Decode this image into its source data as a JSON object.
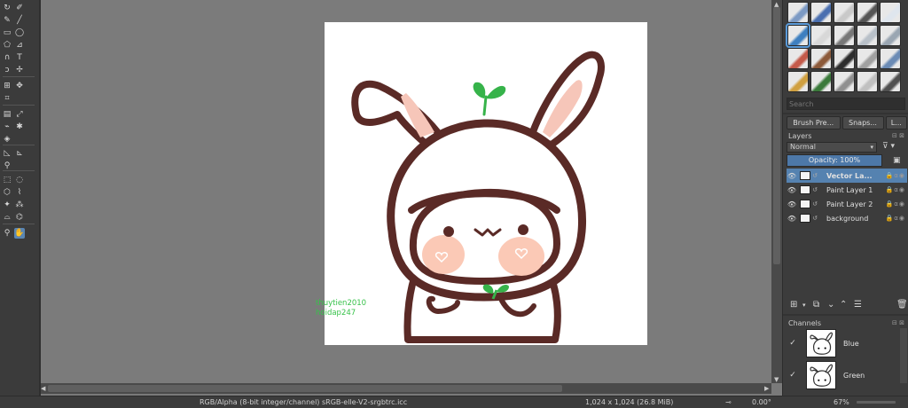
{
  "toolbox": {
    "tools": [
      {
        "name": "transform-tool-icon",
        "glyph": "↻"
      },
      {
        "name": "pick-tool-icon",
        "glyph": "✐"
      },
      {
        "name": "freehand-brush-icon",
        "glyph": "✎"
      },
      {
        "name": "line-tool-icon",
        "glyph": "╱"
      },
      {
        "name": "rectangle-tool-icon",
        "glyph": "▭"
      },
      {
        "name": "ellipse-tool-icon",
        "glyph": "◯"
      },
      {
        "name": "polygon-tool-icon",
        "glyph": "⬠"
      },
      {
        "name": "polyline-tool-icon",
        "glyph": "⊿"
      },
      {
        "name": "bezier-tool-icon",
        "glyph": "∩"
      },
      {
        "name": "text-tool-icon",
        "glyph": "T"
      },
      {
        "name": "freehand-path-icon",
        "glyph": "ↄ"
      },
      {
        "name": "multibrush-icon",
        "glyph": "✢"
      },
      {
        "name": "transform-layer-icon",
        "glyph": "⊞"
      },
      {
        "name": "move-tool-icon",
        "glyph": "✥"
      },
      {
        "name": "crop-tool-icon",
        "glyph": "⌗"
      },
      {
        "name": "gradient-tool-icon",
        "glyph": "▤"
      },
      {
        "name": "color-picker-icon",
        "glyph": "⤢"
      },
      {
        "name": "smart-patch-icon",
        "glyph": "⌁"
      },
      {
        "name": "assistant-tool-icon",
        "glyph": "✱"
      },
      {
        "name": "fill-tool-icon",
        "glyph": "◈"
      },
      {
        "name": "measure-tool-icon",
        "glyph": "◺"
      },
      {
        "name": "reference-tool-icon",
        "glyph": "⊾"
      },
      {
        "name": "pin-tool-icon",
        "glyph": "⚲"
      },
      {
        "name": "rect-select-icon",
        "glyph": "⬚"
      },
      {
        "name": "ellipse-select-icon",
        "glyph": "◌"
      },
      {
        "name": "polygon-select-icon",
        "glyph": "⬡"
      },
      {
        "name": "freehand-select-icon",
        "glyph": "⌇"
      },
      {
        "name": "contiguous-select-icon",
        "glyph": "✦"
      },
      {
        "name": "similar-select-icon",
        "glyph": "⁂"
      },
      {
        "name": "bezier-select-icon",
        "glyph": "⌓"
      },
      {
        "name": "magnetic-select-icon",
        "glyph": "⌬"
      },
      {
        "name": "zoom-tool-icon",
        "glyph": "⚲"
      },
      {
        "name": "pan-tool-icon",
        "glyph": "✋"
      }
    ]
  },
  "watermark": {
    "line1": "thuytien2010",
    "line2": "hoidap247"
  },
  "statusbar": {
    "color_space": "RGB/Alpha (8-bit integer/channel)  sRGB-elle-V2-srgbtrc.icc",
    "image_size": "1,024 x 1,024 (26.8 MiB)",
    "rotation": "0.00°",
    "zoom": "67%"
  },
  "docker": {
    "search_placeholder": "Search",
    "tabs": [
      "Brush Pre...",
      "Snaps...",
      "L..."
    ],
    "layers_title": "Layers",
    "blend_mode": "Normal",
    "opacity": "Opacity:  100%",
    "layers": [
      {
        "name": "Vector La...",
        "selected": true
      },
      {
        "name": "Paint Layer 1",
        "selected": false
      },
      {
        "name": "Paint Layer 2",
        "selected": false
      },
      {
        "name": "background",
        "selected": false
      }
    ],
    "channels_title": "Channels",
    "channels": [
      {
        "name": "Blue"
      },
      {
        "name": "Green"
      }
    ]
  },
  "colors": {
    "accent": "#5582b0",
    "canvas_bg": "#7b7b7b",
    "outline": "#5a2a26",
    "ear_pink": "#f6c6b9",
    "blush": "#fbc9b6",
    "sprout": "#36b34a",
    "watermark": "#37c24a"
  }
}
